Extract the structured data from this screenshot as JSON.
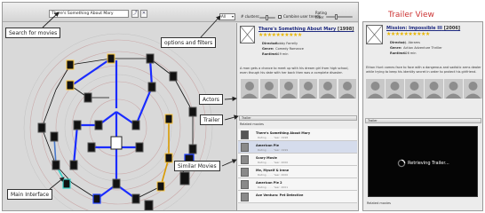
{
  "toolbar": {
    "search_value": "There's Something About Mary",
    "search_go_icon": "search-go-icon",
    "clear_icon": "clear-icon",
    "filter_value": "All",
    "slider_left_label": "# clusters:",
    "combine_label": "Combine user trends",
    "slider_right_label_top": "Rating",
    "slider_right_label_bottom": "filter"
  },
  "main_movie": {
    "title": "There's Something About Mary",
    "year": "[1998]",
    "stars": "★★★★★★★★★★",
    "director_label": "Director:",
    "director": "Bobby Farrelly",
    "genre_label": "Genre:",
    "genre": "Comedy Romance",
    "runtime_label": "Runtime:",
    "runtime": "119 min",
    "synopsis": "A man gets a chance to meet up with his dream girl from high school, even though his date with her back then was a complete disaster."
  },
  "sections": {
    "trailer_bar": "Trailer",
    "related_tab": "Related movies"
  },
  "similar_movies": [
    {
      "title": "There's Something About Mary",
      "meta": "Rating · · · · Year: 1998"
    },
    {
      "title": "American Pie",
      "meta": "Rating · · · · Year: 1999"
    },
    {
      "title": "Scary Movie",
      "meta": "Rating · · · · Year: 2000"
    },
    {
      "title": "Me, Myself & Irene",
      "meta": "Rating · · · · Year: 2000"
    },
    {
      "title": "American Pie 2",
      "meta": "Rating · · · · Year: 2001"
    },
    {
      "title": "Ace Ventura: Pet Detective",
      "meta": ""
    }
  ],
  "trailer_view": {
    "heading": "Trailer View",
    "title": "Mission: Impossible III",
    "year": "[2006]",
    "stars": "★★★★★★★★★★",
    "director_label": "Director:",
    "director": "J.J. Abrams",
    "genre_label": "Genre:",
    "genre": "Action Adventure Thriller",
    "runtime_label": "Runtime:",
    "runtime": "126 min",
    "synopsis": "Ethan Hunt comes face to face with a dangerous and sadistic arms dealer while trying to keep his identity secret in order to protect his girlfriend.",
    "trailer_bar": "Trailer",
    "retrieving_text": "Retrieving Trailer...",
    "related_tab": "Related movies"
  },
  "callouts": {
    "search": "Search for movies",
    "options": "options and filters",
    "actors": "Actors",
    "trailer": "Trailer",
    "similar": "Similar Movies",
    "main": "Main Interface"
  },
  "colors": {
    "blue_edge": "#1a2cff",
    "orange_edge": "#d99a00",
    "teal_edge": "#3ad0c8",
    "black_edge": "#111111",
    "star": "#e8b400",
    "heading_red": "#cc3333",
    "title_blue": "#1e2a80"
  }
}
